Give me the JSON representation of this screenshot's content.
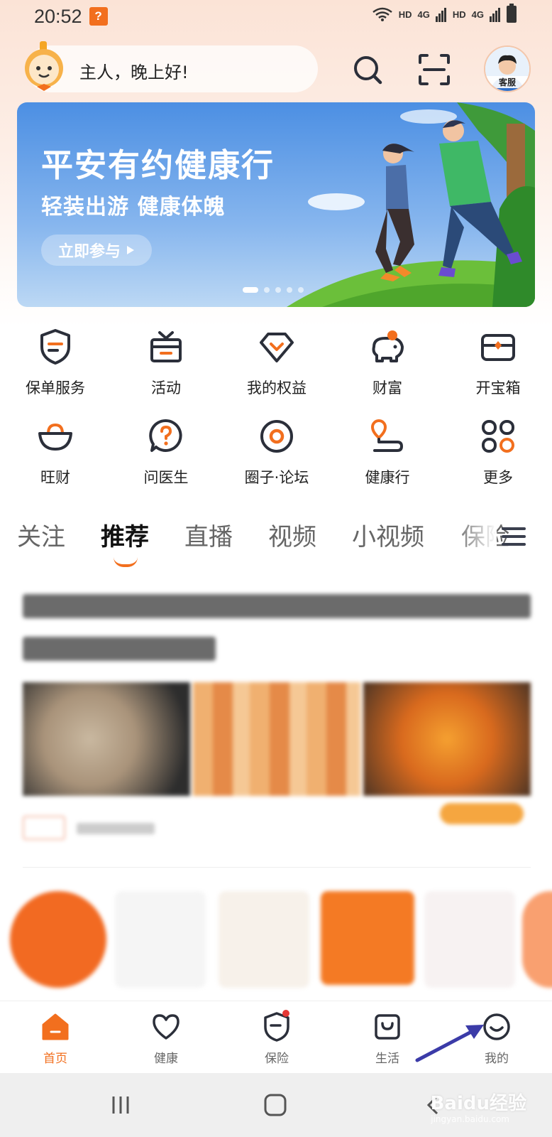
{
  "status_bar": {
    "time": "20:52",
    "notification_badge": "?",
    "network_labels": [
      "HD",
      "4G",
      "HD",
      "4G"
    ]
  },
  "header": {
    "greeting": "主人，晚上好!",
    "avatar_label": "客服",
    "icons": [
      "search-icon",
      "scan-icon"
    ]
  },
  "banner": {
    "title": "平安有约健康行",
    "subtitle": "轻装出游 健康体魄",
    "button_label": "立即参与",
    "slide_count": 5,
    "active_slide": 1
  },
  "grid": {
    "items": [
      {
        "label": "保单服务",
        "icon": "policy-shield-icon"
      },
      {
        "label": "活动",
        "icon": "gift-box-icon"
      },
      {
        "label": "我的权益",
        "icon": "diamond-icon"
      },
      {
        "label": "财富",
        "icon": "piggy-bank-icon"
      },
      {
        "label": "开宝箱",
        "icon": "treasure-chest-icon"
      },
      {
        "label": "旺财",
        "icon": "gold-ingot-icon"
      },
      {
        "label": "问医生",
        "icon": "question-bubble-icon"
      },
      {
        "label": "圈子·论坛",
        "icon": "circle-target-icon"
      },
      {
        "label": "健康行",
        "icon": "route-icon"
      },
      {
        "label": "更多",
        "icon": "more-grid-icon"
      }
    ]
  },
  "tabs": {
    "items": [
      "关注",
      "推荐",
      "直播",
      "视频",
      "小视频",
      "保险"
    ],
    "active": "推荐",
    "menu_icon": "hamburger-menu-icon"
  },
  "bottom_nav": {
    "items": [
      {
        "label": "首页",
        "icon": "home-icon",
        "active": true
      },
      {
        "label": "健康",
        "icon": "heart-icon",
        "active": false
      },
      {
        "label": "保险",
        "icon": "shield-icon",
        "active": false,
        "badge_dot": true
      },
      {
        "label": "生活",
        "icon": "shopping-bag-icon",
        "active": false
      },
      {
        "label": "我的",
        "icon": "smiley-face-icon",
        "active": false
      }
    ]
  },
  "watermark": {
    "text": "Baidu经验",
    "sub": "jingyan.baidu.com"
  },
  "colors": {
    "accent": "#f26f1e",
    "banner_blue": "#4c8fe3",
    "icon_dark": "#2b2f3a",
    "annotation_arrow": "#3b3ba8"
  }
}
